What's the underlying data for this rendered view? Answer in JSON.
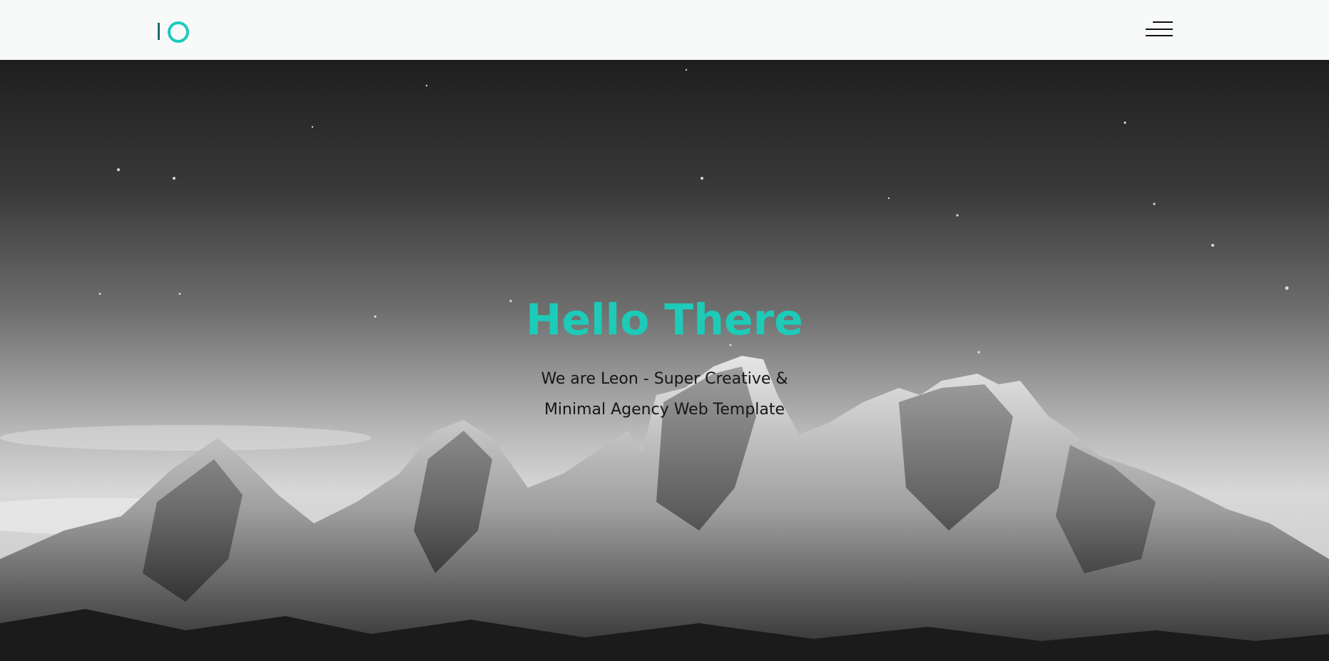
{
  "header": {
    "logo": {
      "bar_color": "#1e6c6a",
      "ring_color": "#1ccbb8"
    },
    "menu_icon": "hamburger-menu-icon"
  },
  "hero": {
    "title": "Hello There",
    "subtitle_line1": "We are Leon - Super Creative &",
    "subtitle_line2": "Minimal Agency Web Template",
    "title_color": "#1ccbb8",
    "background_description_icon": "mountain-background-image"
  }
}
